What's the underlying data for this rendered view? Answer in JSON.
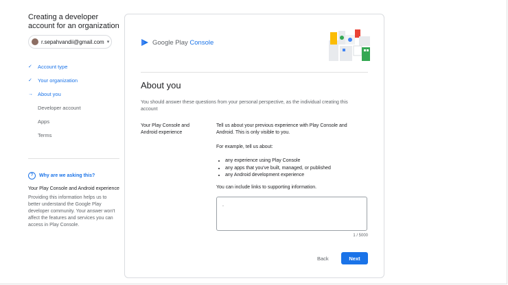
{
  "sidebar": {
    "title": "Creating a developer account for an organization",
    "account_email": "r.sepahvandii@gmail.com",
    "steps": [
      {
        "label": "Account type",
        "state": "done"
      },
      {
        "label": "Your organization",
        "state": "done"
      },
      {
        "label": "About you",
        "state": "current"
      },
      {
        "label": "Developer account",
        "state": "todo"
      },
      {
        "label": "Apps",
        "state": "todo"
      },
      {
        "label": "Terms",
        "state": "todo"
      }
    ],
    "why": {
      "heading": "Why are we asking this?",
      "subheading": "Your Play Console and Android experience",
      "body": "Providing this information helps us to better understand the Google Play developer community. Your answer won't affect the features and services you can access in Play Console."
    }
  },
  "card": {
    "brand_text": "Google Play ",
    "brand_suffix": "Console",
    "title": "About you",
    "intro": "You should answer these questions from your personal perspective, as the individual creating this account",
    "field_label": "Your Play Console and Android experience",
    "question": "Tell us about your previous experience with Play Console and Android. This is only visible to you.",
    "example_intro": "For example, tell us about:",
    "bullets": [
      "any experience using Play Console",
      "any apps that you've built, managed, or published",
      "any Android development experience"
    ],
    "links_note": "You can include links to supporting information.",
    "textarea_value": ".",
    "counter": "1 / 5000",
    "back_label": "Back",
    "next_label": "Next"
  },
  "colors": {
    "accent": "#1a73e8",
    "muted_text": "#5f6368",
    "border": "#dadce0"
  }
}
